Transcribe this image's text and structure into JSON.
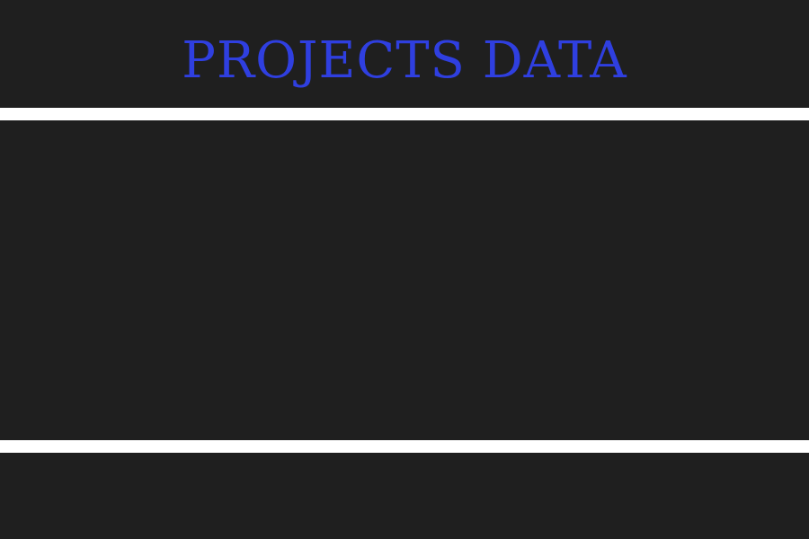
{
  "header": {
    "title": "PROJECTS DATA"
  },
  "colors": {
    "background": "#1f1f1f",
    "title": "#2f3fe0",
    "divider": "#ffffff"
  }
}
